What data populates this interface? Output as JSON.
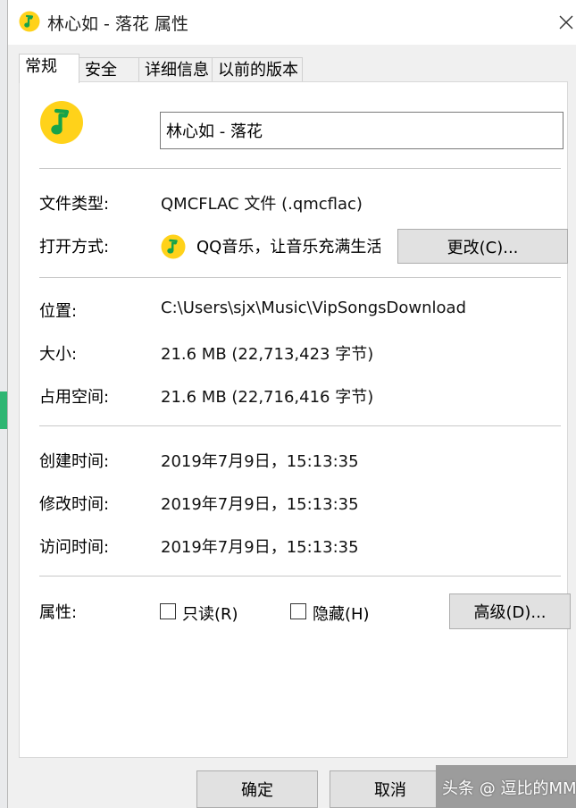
{
  "window": {
    "title": "林心如 - 落花 属性"
  },
  "tabs": [
    {
      "label": "常规",
      "active": true
    },
    {
      "label": "安全",
      "active": false
    },
    {
      "label": "详细信息",
      "active": false
    },
    {
      "label": "以前的版本",
      "active": false
    }
  ],
  "general": {
    "file_name": "林心如 - 落花",
    "file_type_label": "文件类型:",
    "file_type_value": "QMCFLAC 文件 (.qmcflac)",
    "opens_with_label": "打开方式:",
    "opens_with_value": "QQ音乐，让音乐充满生活",
    "change_button": "更改(C)...",
    "location_label": "位置:",
    "location_value": "C:\\Users\\sjx\\Music\\VipSongsDownload",
    "size_label": "大小:",
    "size_value": "21.6 MB (22,713,423 字节)",
    "size_on_disk_label": "占用空间:",
    "size_on_disk_value": "21.6 MB (22,716,416 字节)",
    "created_label": "创建时间:",
    "created_value": "2019年7月9日，15:13:35",
    "modified_label": "修改时间:",
    "modified_value": "2019年7月9日，15:13:35",
    "accessed_label": "访问时间:",
    "accessed_value": "2019年7月9日，15:13:35",
    "attributes_label": "属性:",
    "readonly_label": "只读(R)",
    "readonly_checked": false,
    "hidden_label": "隐藏(H)",
    "hidden_checked": false,
    "advanced_button": "高级(D)..."
  },
  "footer": {
    "ok_button": "确定",
    "cancel_button": "取消"
  },
  "watermark": "头条 @ 逗比的MM",
  "colors": {
    "qq_music_yellow": "#ffd21a",
    "qq_music_green": "#16a34a"
  },
  "icons": {
    "app": "qq-music-icon",
    "close": "close-icon"
  }
}
